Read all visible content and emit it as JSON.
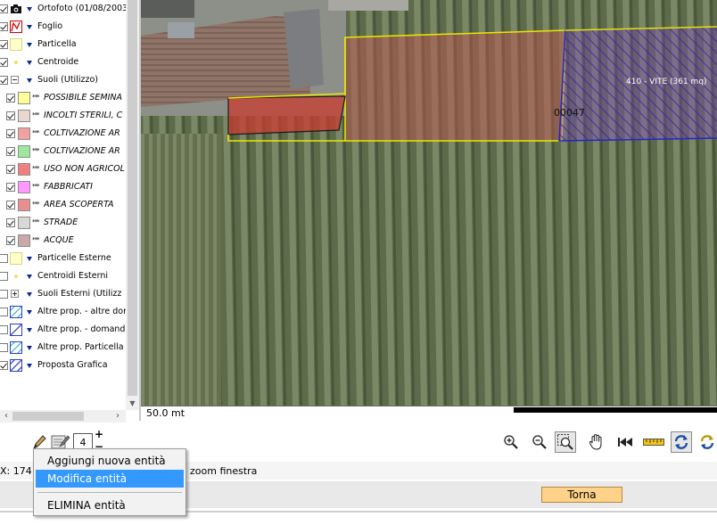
{
  "layers": [
    {
      "label": "Ortofoto (01/08/2003",
      "checked": true,
      "symbol": "camera-icon"
    },
    {
      "label": "Foglio",
      "checked": true,
      "symbol": "polygon-red-outline"
    },
    {
      "label": "Particella",
      "checked": true,
      "symbol": "polygon-yellow-outline"
    },
    {
      "label": "Centroide",
      "checked": true,
      "symbol": "point-yellow"
    },
    {
      "label": "Suoli (Utilizzo)",
      "checked": true,
      "symbol": "expander-minus"
    }
  ],
  "sublayers": [
    {
      "label": "POSSIBILE SEMINA",
      "color": "#ffff99"
    },
    {
      "label": "INCOLTI STERILI, C",
      "color": "#e8d8d0"
    },
    {
      "label": "COLTIVAZIONE AR",
      "color": "#f4a0a0"
    },
    {
      "label": "COLTIVAZIONE AR",
      "color": "#9ee89e"
    },
    {
      "label": "USO NON AGRICOL",
      "color": "#f08080"
    },
    {
      "label": "FABBRICATI",
      "color": "#ff99ff"
    },
    {
      "label": "AREA SCOPERTA",
      "color": "#e89090"
    },
    {
      "label": "STRADE",
      "color": "#d8d8d8"
    },
    {
      "label": "ACQUE",
      "color": "#c8a8a8"
    }
  ],
  "external_layers": [
    {
      "label": "Particelle Esterne",
      "checked": false,
      "symbol": "polygon-yellow-outline"
    },
    {
      "label": "Centroidi Esterni",
      "checked": false,
      "symbol": "point-yellow"
    },
    {
      "label": "Suoli Esterni (Utilizz",
      "checked": false,
      "symbol": "expander-plus"
    },
    {
      "label": "Altre prop. - altre dom",
      "checked": false,
      "symbol": "hatch-blue"
    },
    {
      "label": "Altre prop. - domand",
      "checked": false,
      "symbol": "hatch-blue"
    },
    {
      "label": "Altre prop. Particella",
      "checked": false,
      "symbol": "hatch-blue"
    },
    {
      "label": "Proposta Grafica",
      "checked": true,
      "symbol": "hatch-blue"
    }
  ],
  "map": {
    "parcel_label": "00047",
    "proposal_label": "410 - VITE (361 mq)",
    "scale_text": "50.0 mt"
  },
  "toolbar": {
    "page_number": "4",
    "plus": "+",
    "minus": "−",
    "tools": [
      "edit-pencil-icon",
      "edit-form-icon",
      "zoom-in-icon",
      "zoom-out-icon",
      "zoom-window-icon",
      "pan-hand-icon",
      "previous-extent-icon",
      "measure-ruler-icon",
      "refresh-icon",
      "refresh-alt-icon"
    ]
  },
  "status": {
    "coords": "X: 174",
    "mode": "zoom finestra"
  },
  "context_menu": {
    "items": [
      "Aggiungi nuova entità",
      "Modifica entità",
      "ELIMINA entità"
    ],
    "selected_index": 1
  },
  "footer": {
    "torna_label": "Torna"
  }
}
